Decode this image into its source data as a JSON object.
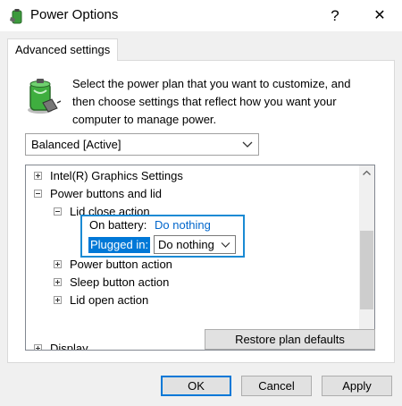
{
  "window": {
    "title": "Power Options",
    "help_glyph": "?",
    "close_glyph": "✕"
  },
  "tab": {
    "label": "Advanced settings"
  },
  "description": "Select the power plan that you want to customize, and then choose settings that reflect how you want your computer to manage power.",
  "plan_select": {
    "value": "Balanced [Active]"
  },
  "tree": {
    "items": [
      {
        "label": "Intel(R) Graphics Settings",
        "expanded": false
      },
      {
        "label": "Power buttons and lid",
        "expanded": true
      },
      {
        "label": "Lid close action",
        "expanded": true
      },
      {
        "label": "Power button action",
        "expanded": false
      },
      {
        "label": "Sleep button action",
        "expanded": false
      },
      {
        "label": "Lid open action",
        "expanded": false
      },
      {
        "label": "Display",
        "expanded": false
      }
    ],
    "lid_close": {
      "on_battery_label": "On battery:",
      "on_battery_value": "Do nothing",
      "plugged_in_label": "Plugged in:",
      "plugged_in_value": "Do nothing"
    }
  },
  "buttons": {
    "restore": "Restore plan defaults",
    "ok": "OK",
    "cancel": "Cancel",
    "apply": "Apply"
  },
  "colors": {
    "accent": "#0078d7",
    "highlight_border": "#1a8ad4",
    "link": "#0066cc"
  },
  "icons": {
    "app": "power-options-battery-icon",
    "plan": "battery-plug-icon"
  }
}
